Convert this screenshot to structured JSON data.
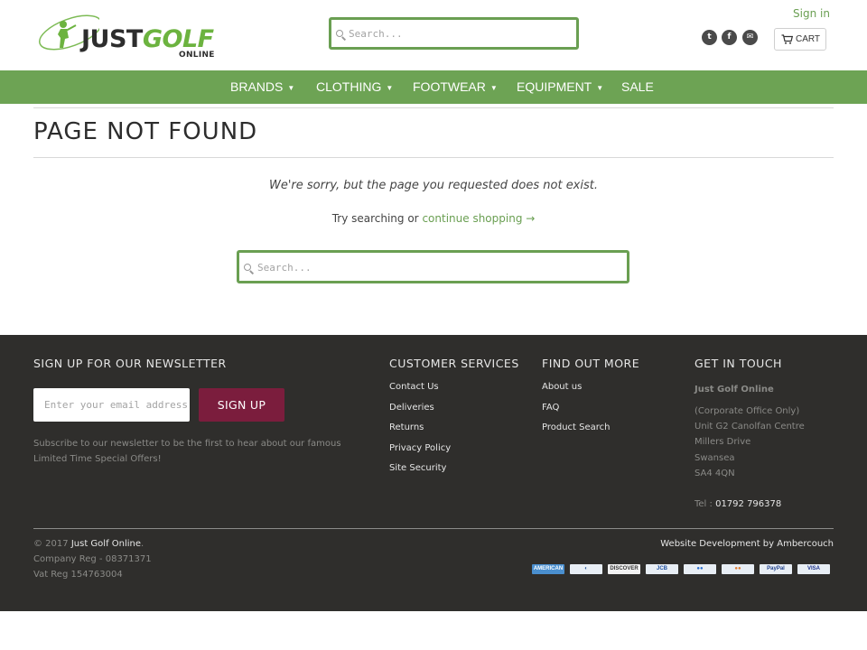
{
  "header": {
    "logo": {
      "word1": "JUST",
      "word2": "GOLF",
      "sub": "ONLINE"
    },
    "search_placeholder": "Search...",
    "signin_label": "Sign in",
    "social": [
      {
        "icon": "twitter-icon",
        "glyph": "t"
      },
      {
        "icon": "facebook-icon",
        "glyph": "f"
      },
      {
        "icon": "email-icon",
        "glyph": "✉"
      }
    ],
    "cart_label": "CART"
  },
  "nav": {
    "items": [
      {
        "label": "BRANDS",
        "dropdown": "▼"
      },
      {
        "label": "CLOTHING",
        "dropdown": "▼"
      },
      {
        "label": "FOOTWEAR",
        "dropdown": "▼"
      },
      {
        "label": "EQUIPMENT",
        "dropdown": "▼"
      },
      {
        "label": "SALE"
      }
    ]
  },
  "main": {
    "title": "PAGE NOT FOUND",
    "sorry_text": "We're sorry, but the page you requested does not exist.",
    "try_text": "Try searching or",
    "continue_link": "continue shopping →",
    "search_placeholder": "Search..."
  },
  "footer": {
    "newsletter": {
      "heading": "SIGN UP FOR OUR NEWSLETTER",
      "email_placeholder": "Enter your email address...",
      "button_label": "SIGN UP",
      "text": "Subscribe to our newsletter to be the first to hear about our famous Limited Time Special Offers!"
    },
    "customer_services": {
      "heading": "CUSTOMER SERVICES",
      "links": [
        "Contact Us",
        "Deliveries",
        "Returns",
        "Privacy Policy",
        "Site Security"
      ]
    },
    "find_out_more": {
      "heading": "FIND OUT MORE",
      "links": [
        "About us",
        "FAQ",
        "Product Search"
      ]
    },
    "get_in_touch": {
      "heading": "GET IN TOUCH",
      "company": "Just Golf Online",
      "address": [
        "(Corporate Office Only)",
        "Unit G2 Canolfan Centre",
        "Millers Drive",
        "Swansea",
        "SA4 4QN"
      ],
      "tel_label": "Tel :",
      "tel": "01792 796378"
    },
    "copyright_prefix": "© 2017",
    "copyright_name": "Just Golf Online",
    "copyright_suffix": ".",
    "company_reg": "Company Reg - 08371371",
    "vat_reg": "Vat Reg 154763004",
    "credit": "Website Development by Ambercouch",
    "payment_cards": [
      {
        "name": "american-express",
        "label": "AMERICAN",
        "bg": "#4a8fcf",
        "fg": "#ffffff"
      },
      {
        "name": "diners-club",
        "label": "◐",
        "bg": "#e8eef5",
        "fg": "#2b5c9e"
      },
      {
        "name": "discover",
        "label": "DISCOVER",
        "bg": "#f2f2f2",
        "fg": "#333333"
      },
      {
        "name": "jcb",
        "label": "JCB",
        "bg": "#e8eef5",
        "fg": "#1f4f9e"
      },
      {
        "name": "maestro",
        "label": "●●",
        "bg": "#e8eef5",
        "fg": "#2b6fd1"
      },
      {
        "name": "mastercard",
        "label": "●●",
        "bg": "#e8eef5",
        "fg": "#e07a2e"
      },
      {
        "name": "paypal",
        "label": "PayPal",
        "bg": "#e8eef5",
        "fg": "#1f3f8a"
      },
      {
        "name": "visa",
        "label": "VISA",
        "bg": "#e8eef5",
        "fg": "#1a2f8a"
      }
    ]
  },
  "colors": {
    "brand_green": "#6da354",
    "footer_bg": "#2f2e2c",
    "signup_button": "#7b1d3d",
    "link_green": "#6a9f52"
  }
}
